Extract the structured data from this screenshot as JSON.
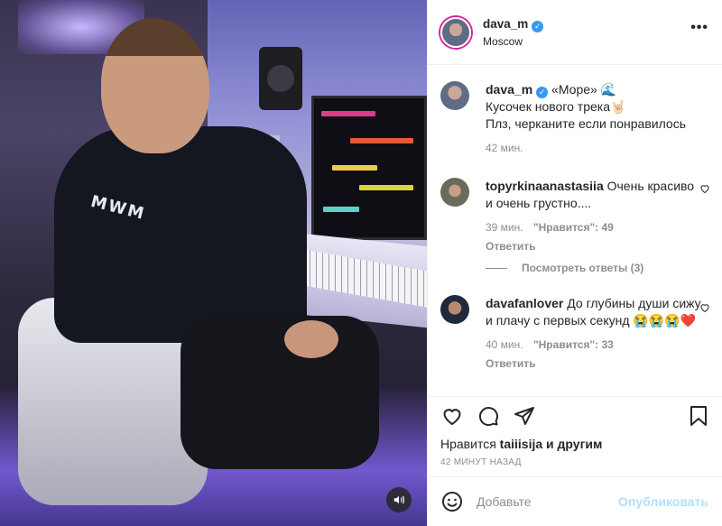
{
  "post": {
    "username": "dava_m",
    "location": "Moscow",
    "verified_mark": "✓",
    "more": "•••"
  },
  "caption": {
    "username": "dava_m",
    "title": "«Море» 🌊",
    "line1": "Кусочек нового трека🤘🏻",
    "line2": "Плз, черканите если понравилось",
    "time": "42 мин."
  },
  "comments": [
    {
      "username": "topyrkinaanastasiia",
      "text": "Очень красиво и очень грустно....",
      "time": "39 мин.",
      "likes": "\"Нравится\": 49",
      "reply": "Ответить",
      "view_replies": "Посмотреть ответы (3)"
    },
    {
      "username": "davafanlover",
      "text": "До глубины души сижу и плачу с первых секунд 😭😭😭❤️",
      "time": "40 мин.",
      "likes": "\"Нравится\": 33",
      "reply": "Ответить"
    }
  ],
  "likes": {
    "prefix": "Нравится",
    "user": "taiiisija",
    "suffix": "и другим"
  },
  "posted_ago": "42 МИНУТ НАЗАД",
  "add_comment": {
    "placeholder": "Добавьте",
    "publish": "Опубликовать"
  },
  "icons": [
    "heart-icon",
    "comment-icon",
    "share-icon",
    "bookmark-icon",
    "emoji-icon",
    "sound-icon",
    "more-icon"
  ],
  "colors": {
    "verified": "#3897f0",
    "publish_disabled": "#b2dffc",
    "meta_gray": "#8e8e8e"
  }
}
